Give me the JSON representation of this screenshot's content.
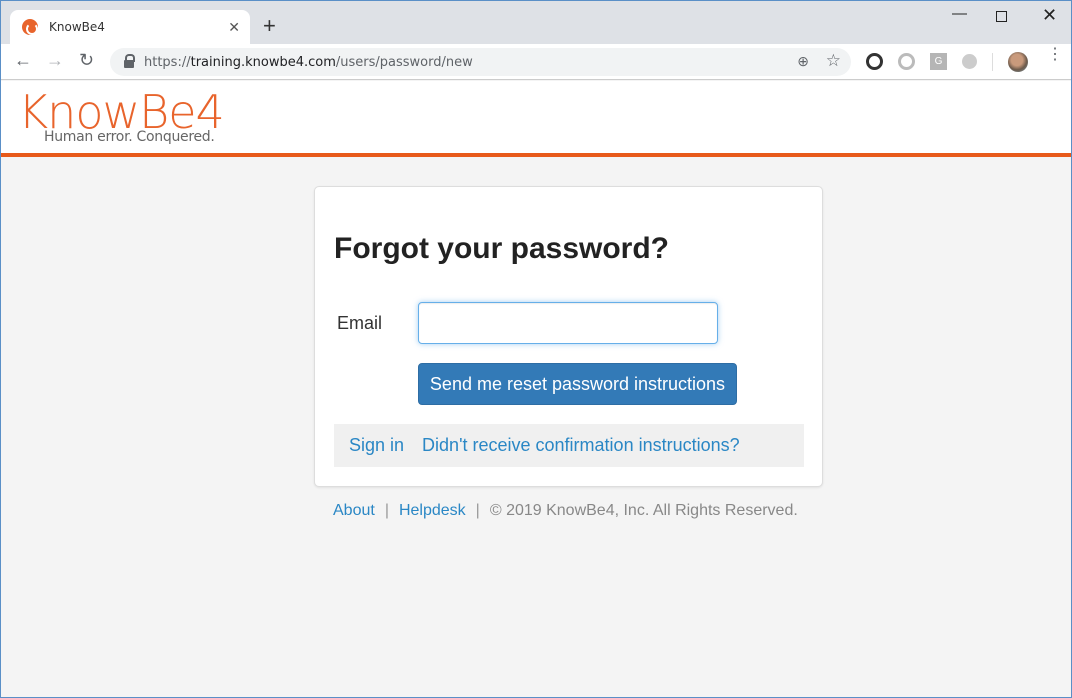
{
  "browser": {
    "tab_title": "KnowBe4",
    "new_tab_icon": "+",
    "url_scheme": "https://",
    "url_host": "training.knowbe4.com",
    "url_path": "/users/password/new",
    "extensions": [
      "ext-dark-circle",
      "ext-grey-circle",
      "G",
      "ext-light-circle"
    ]
  },
  "header": {
    "logo_text": "KnowBe4",
    "tagline": "Human error. Conquered.",
    "accent_color": "#e85a1a"
  },
  "form": {
    "title": "Forgot your password?",
    "email_label": "Email",
    "email_value": "",
    "email_placeholder": "",
    "submit_label": "Send me reset password instructions",
    "links": {
      "sign_in": "Sign in",
      "no_confirmation": "Didn't receive confirmation instructions?"
    }
  },
  "footer": {
    "about": "About",
    "helpdesk": "Helpdesk",
    "separator": "|",
    "copyright": "© 2019 KnowBe4, Inc. All Rights Reserved."
  }
}
